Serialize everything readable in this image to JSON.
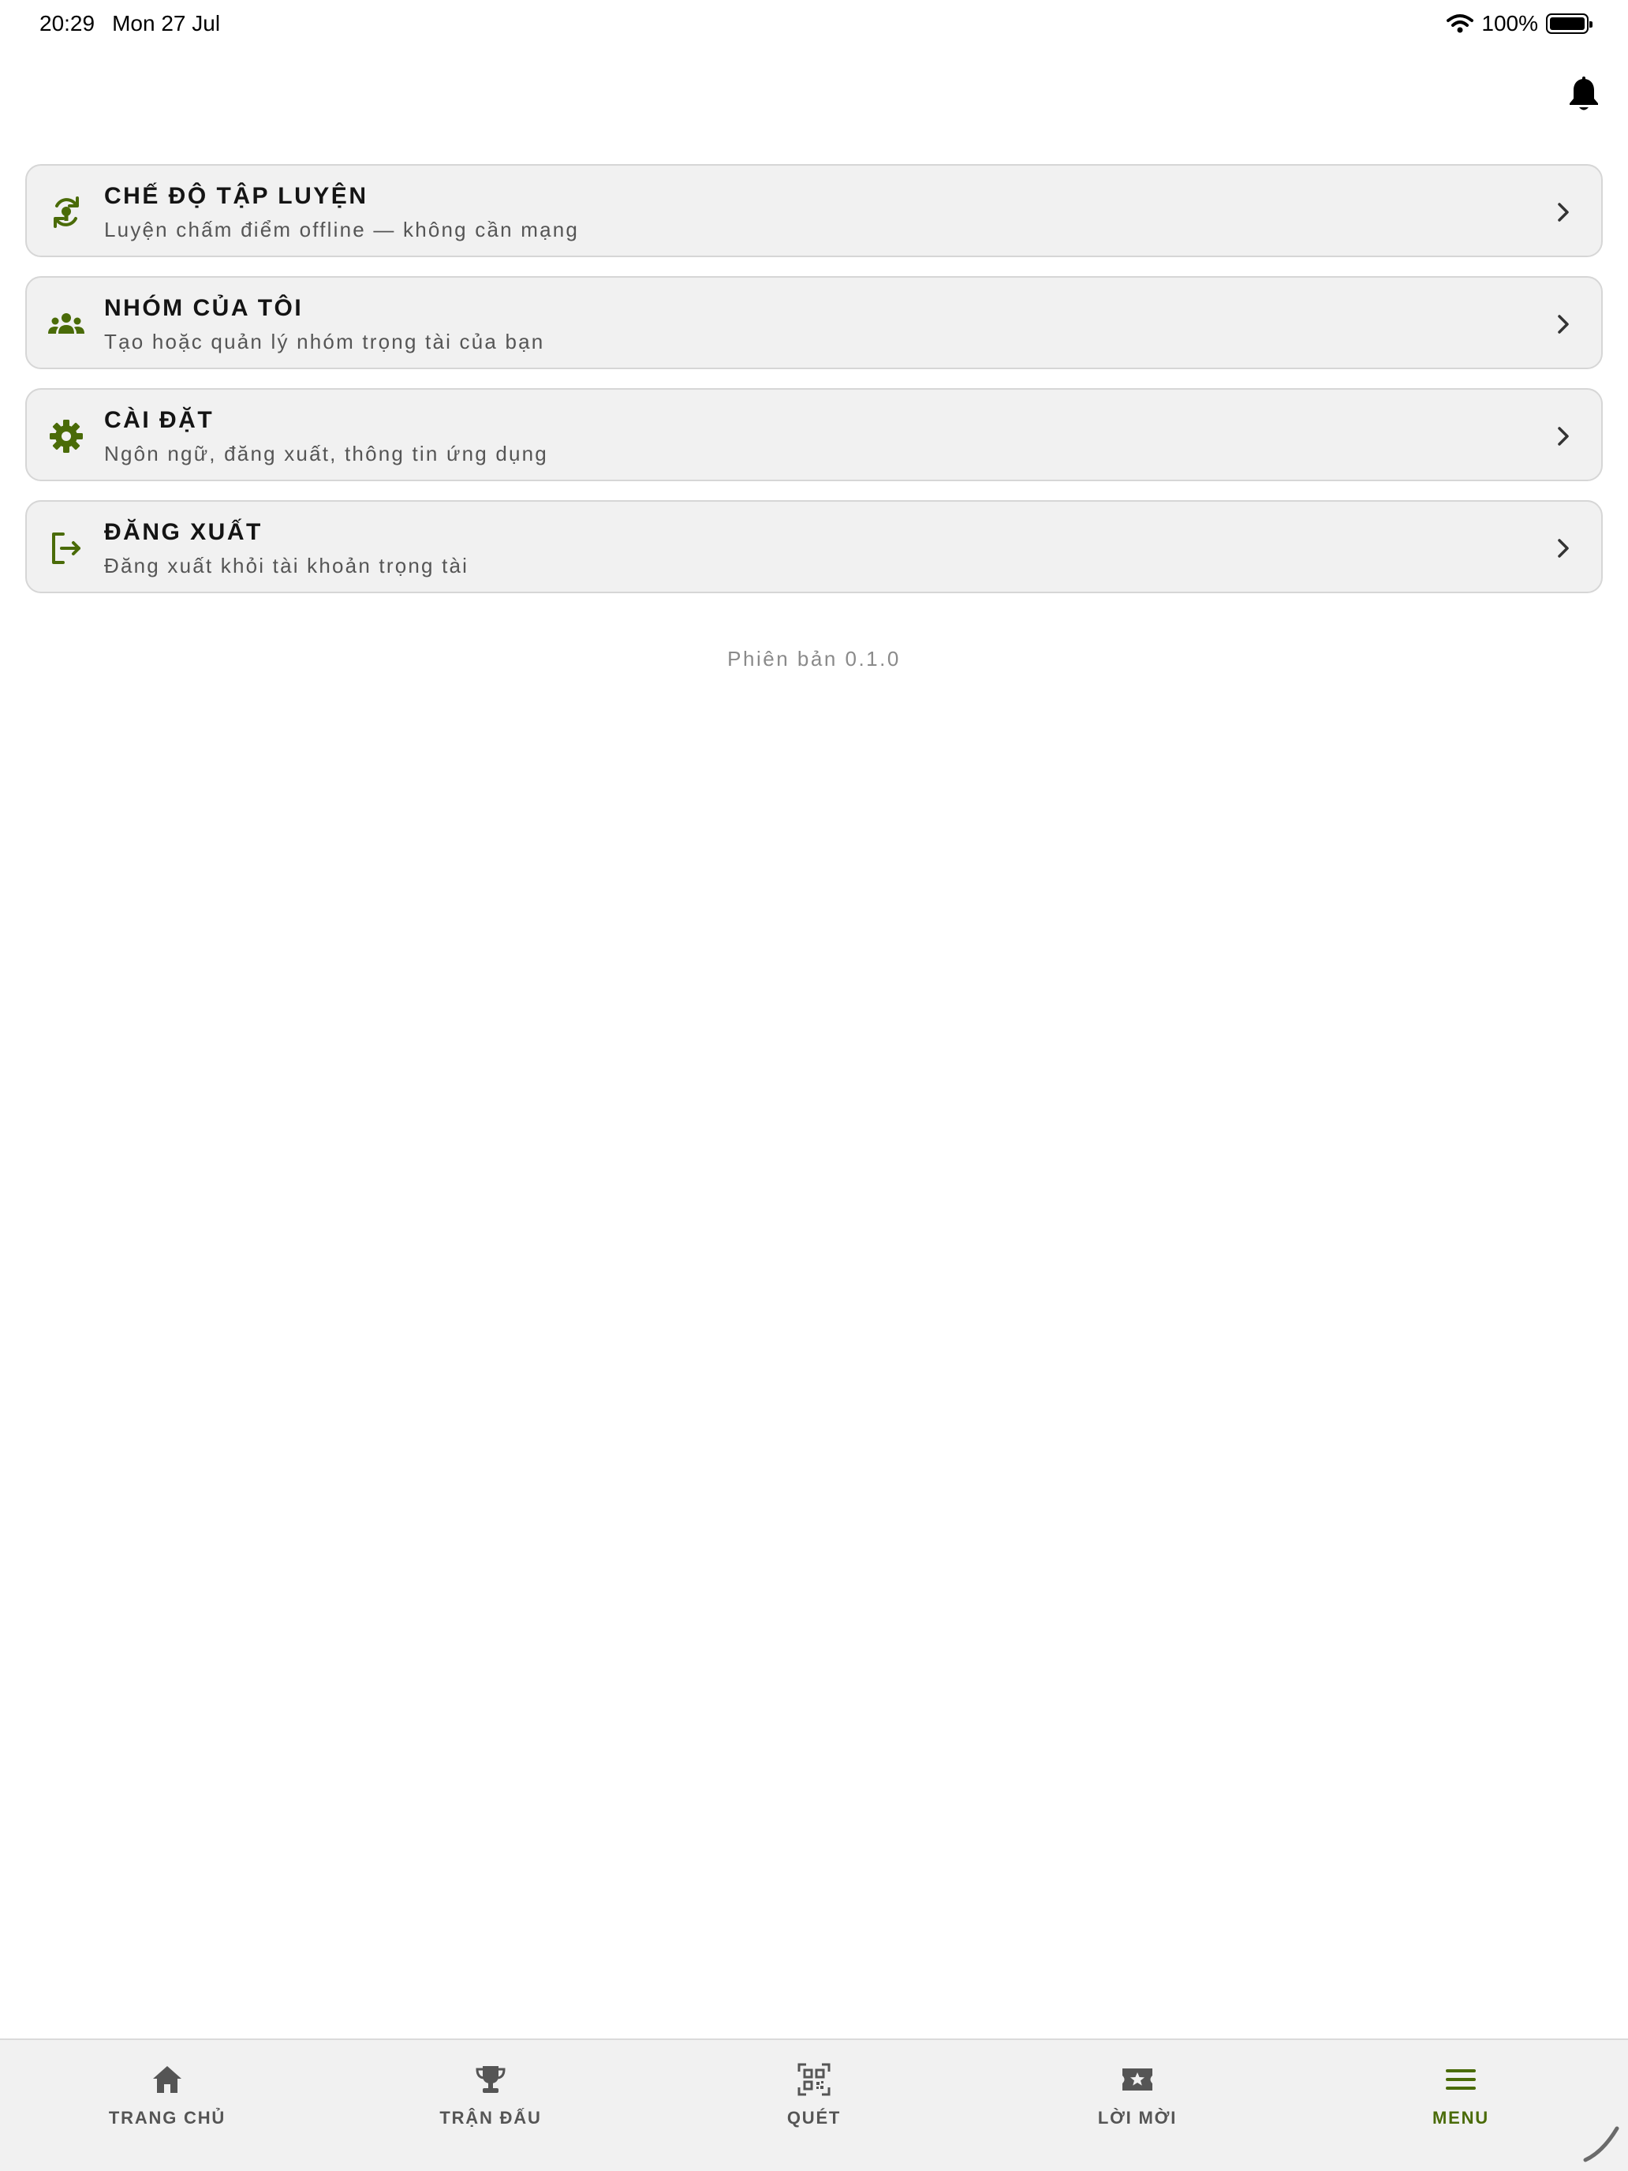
{
  "status_bar": {
    "time": "20:29",
    "date": "Mon 27 Jul",
    "battery": "100%",
    "wifi_icon": "wifi-icon",
    "battery_icon": "battery-icon"
  },
  "header": {
    "notification_icon": "bell-icon"
  },
  "menu": {
    "items": [
      {
        "icon": "practice-cycle-icon",
        "title": "CHẾ ĐỘ TẬP LUYỆN",
        "subtitle": "Luyện chấm điểm offline — không cần mạng"
      },
      {
        "icon": "group-icon",
        "title": "NHÓM CỦA TÔI",
        "subtitle": "Tạo hoặc quản lý nhóm trọng tài của bạn"
      },
      {
        "icon": "gear-icon",
        "title": "CÀI ĐẶT",
        "subtitle": "Ngôn ngữ, đăng xuất, thông tin ứng dụng"
      },
      {
        "icon": "logout-icon",
        "title": "ĐĂNG XUẤT",
        "subtitle": "Đăng xuất khỏi tài khoản trọng tài"
      }
    ]
  },
  "version": "Phiên bản 0.1.0",
  "tabs": [
    {
      "label": "TRANG CHỦ",
      "icon": "home-icon",
      "active": false
    },
    {
      "label": "TRẬN ĐẤU",
      "icon": "trophy-icon",
      "active": false
    },
    {
      "label": "QUÉT",
      "icon": "qr-scan-icon",
      "active": false
    },
    {
      "label": "LỜI MỜI",
      "icon": "ticket-star-icon",
      "active": false
    },
    {
      "label": "MENU",
      "icon": "menu-icon",
      "active": true
    }
  ],
  "colors": {
    "accent": "#4a6b08",
    "card_bg": "#f1f1f1",
    "muted_text": "#555555"
  }
}
